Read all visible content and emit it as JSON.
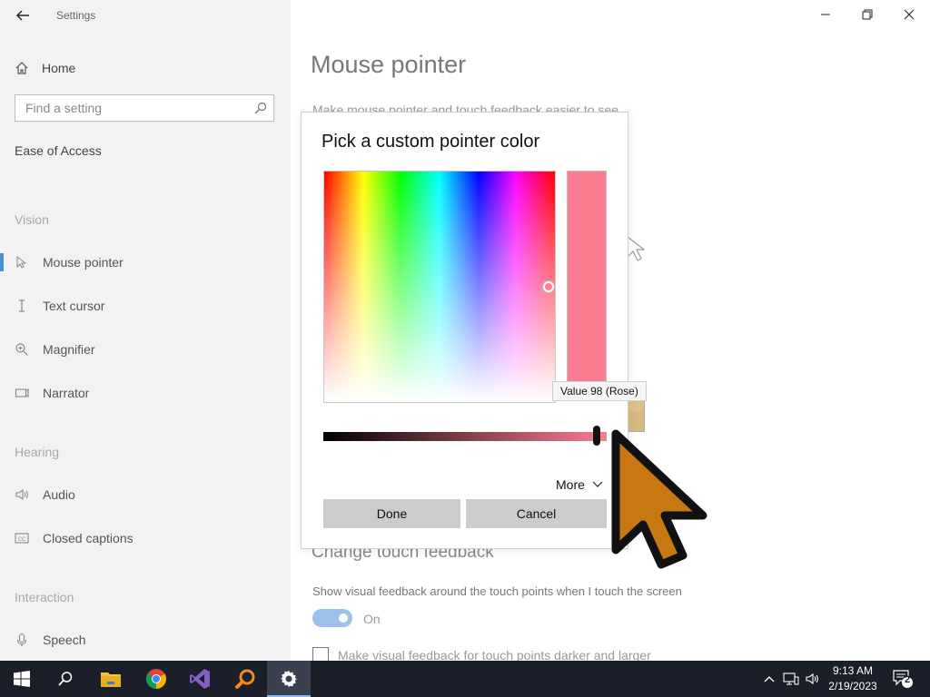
{
  "window": {
    "app_title": "Settings",
    "accent": "#4a90d9"
  },
  "nav": {
    "home_label": "Home",
    "search_placeholder": "Find a setting",
    "section_title": "Ease of Access",
    "groups": {
      "vision": "Vision",
      "hearing": "Hearing",
      "interaction": "Interaction"
    },
    "items": [
      {
        "label": "Mouse pointer",
        "icon": "mouse-pointer-icon",
        "selected": true
      },
      {
        "label": "Text cursor",
        "icon": "text-cursor-icon"
      },
      {
        "label": "Magnifier",
        "icon": "magnifier-icon"
      },
      {
        "label": "Narrator",
        "icon": "narrator-icon"
      },
      {
        "label": "Audio",
        "icon": "speaker-icon"
      },
      {
        "label": "Closed captions",
        "icon": "closed-captions-icon"
      },
      {
        "label": "Speech",
        "icon": "microphone-icon"
      }
    ]
  },
  "main": {
    "title": "Mouse pointer",
    "description": "Make mouse pointer and touch feedback easier to see.",
    "touch_heading": "Change touch feedback",
    "touch_description": "Show visual feedback around the touch points when I touch the screen",
    "toggle_state": "On",
    "checkbox_label": "Make visual feedback for touch points darker and larger"
  },
  "dialog": {
    "title": "Pick a custom pointer color",
    "preview_color": "#fa7d92",
    "value_tooltip": "Value 98 (Rose)",
    "value": 98,
    "more_label": "More",
    "done_label": "Done",
    "cancel_label": "Cancel"
  },
  "taskbar": {
    "apps": [
      "windows-start-icon",
      "search-icon",
      "file-explorer-icon",
      "chrome-icon",
      "visual-studio-icon",
      "magnifier-app-icon",
      "settings-gear-icon"
    ],
    "time": "9:13 AM",
    "date": "2/19/2023",
    "notification_count": "2"
  },
  "cursor_color": "#c87811"
}
